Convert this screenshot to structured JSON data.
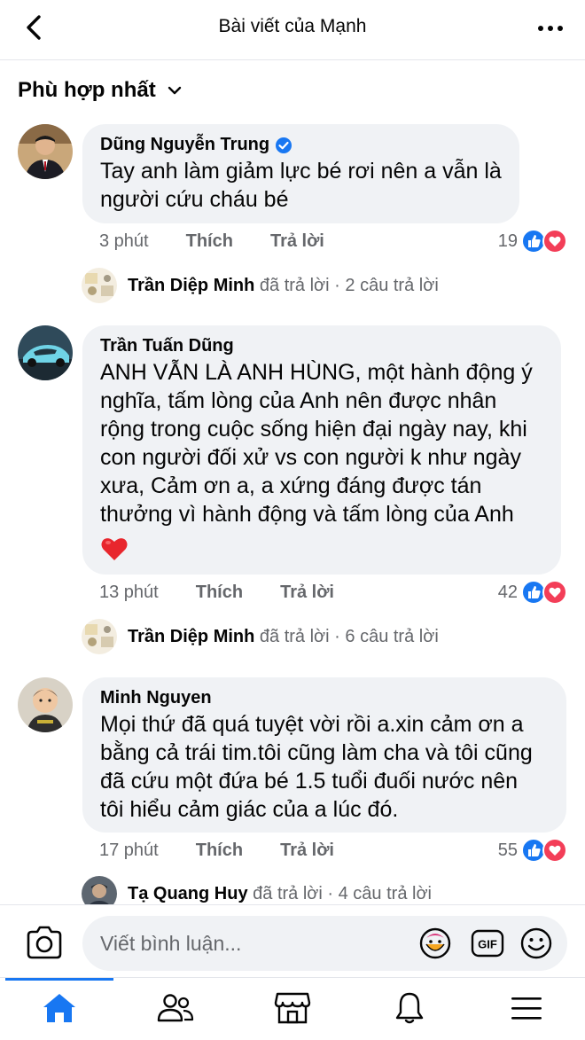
{
  "header": {
    "title": "Bài viết của Mạnh"
  },
  "sort": {
    "label": "Phù hợp nhất"
  },
  "comments": [
    {
      "author": "Dũng Nguyễn Trung",
      "verified": true,
      "text_lines": [
        "Tay anh làm giảm lực bé rơi nên a vẫn là",
        "người cứu cháu bé"
      ],
      "time": "3 phút",
      "like_label": "Thích",
      "reply_label": "Trả lời",
      "reaction_count": "19",
      "replies": {
        "name": "Trần Diệp Minh",
        "action": "đã trả lời",
        "count": "· 2 câu trả lời"
      }
    },
    {
      "author": "Trần Tuấn Dũng",
      "verified": false,
      "text_lines": [
        "ANH VẪN LÀ ANH HÙNG, một hành động ý",
        "nghĩa, tấm lòng của Anh nên được nhân",
        "rộng trong cuộc sống hiện đại ngày nay, khi",
        "con người đối xử vs con người k như ngày",
        "xưa, Cảm ơn a, a xứng đáng được tán",
        "thưởng vì hành động và tấm lòng của Anh"
      ],
      "time": "13 phút",
      "like_label": "Thích",
      "reply_label": "Trả lời",
      "reaction_count": "42",
      "replies": {
        "name": "Trần Diệp Minh",
        "action": "đã trả lời",
        "count": "· 6 câu trả lời"
      }
    },
    {
      "author": "Minh Nguyen",
      "verified": false,
      "text_lines": [
        "Mọi thứ đã quá tuyệt vời rồi a.xin cảm ơn a",
        "bằng cả trái tim.tôi cũng làm cha và tôi cũng",
        "đã cứu một đứa bé 1.5 tuổi đuối nước nên",
        "tôi hiểu cảm giác của a lúc đó."
      ],
      "time": "17 phút",
      "like_label": "Thích",
      "reply_label": "Trả lời",
      "reaction_count": "55",
      "replies": {
        "name": "Tạ Quang Huy",
        "action": "đã trả lời",
        "count": "· 4 câu trả lời"
      }
    }
  ],
  "composer": {
    "placeholder": "Viết bình luận..."
  },
  "colors": {
    "accent": "#1877f2",
    "bubble": "#f0f2f5",
    "muted": "#65676b",
    "love": "#f33e58"
  },
  "icons": [
    "back-arrow-icon",
    "more-icon",
    "chevron-down-icon",
    "verified-icon",
    "like-icon",
    "love-icon",
    "heart-emoji",
    "camera-icon",
    "avatar-sticker-icon",
    "gif-icon",
    "emoji-icon",
    "home-icon",
    "friends-icon",
    "marketplace-icon",
    "bell-icon",
    "menu-icon"
  ]
}
